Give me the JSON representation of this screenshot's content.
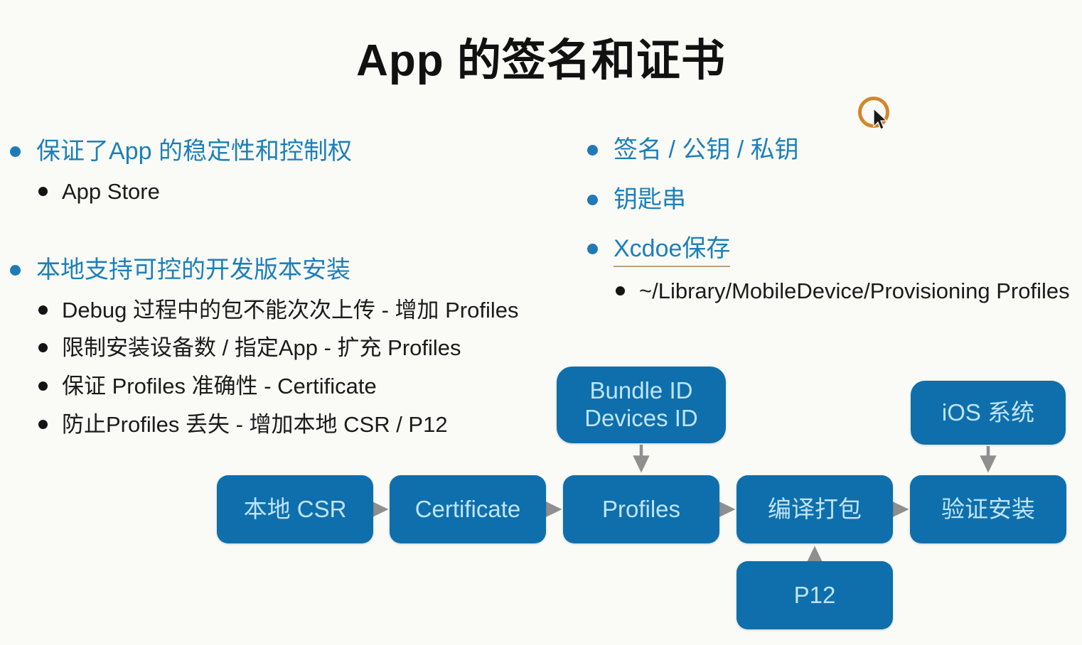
{
  "slide": {
    "title": "App 的签名和证书",
    "background_color": "#fafbf7",
    "accent_blue": "#1d7fb9",
    "node_fill": "#0e6fac",
    "node_text_color": "#bfe4f7",
    "arrow_color": "#8f8f8f",
    "cursor_ring_color": "#d4862a"
  },
  "left_column": {
    "bullet1": "保证了App 的稳定性和控制权",
    "bullet1_sub": [
      "App Store"
    ],
    "bullet2": "本地支持可控的开发版本安装",
    "bullet2_sub": [
      "Debug 过程中的包不能次次上传 - 增加 Profiles",
      "限制安装设备数 / 指定App - 扩充 Profiles",
      "保证 Profiles 准确性 - Certificate",
      "防止Profiles 丢失 - 增加本地 CSR / P12"
    ]
  },
  "right_column": {
    "bullet1": "签名 / 公钥 / 私钥",
    "bullet2": "钥匙串",
    "bullet3": "Xcdoe保存",
    "bullet3_sub": [
      "~/Library/MobileDevice/Provisioning Profiles"
    ]
  },
  "diagram": {
    "nodes": {
      "bundle": "Bundle  ID\nDevices ID",
      "ios": "iOS 系统",
      "csr": "本地 CSR",
      "certificate": "Certificate",
      "profiles": "Profiles",
      "build": "编译打包",
      "verify": "验证安装",
      "p12": "P12"
    },
    "edges": [
      {
        "from": "csr",
        "to": "certificate",
        "direction": "right"
      },
      {
        "from": "certificate",
        "to": "profiles",
        "direction": "right"
      },
      {
        "from": "profiles",
        "to": "build",
        "direction": "right"
      },
      {
        "from": "build",
        "to": "verify",
        "direction": "right"
      },
      {
        "from": "bundle",
        "to": "profiles",
        "direction": "down"
      },
      {
        "from": "ios",
        "to": "verify",
        "direction": "down"
      },
      {
        "from": "p12",
        "to": "build",
        "direction": "up"
      }
    ]
  },
  "cursor": {
    "icon": "mouse-pointer",
    "highlight": "click-ring"
  }
}
